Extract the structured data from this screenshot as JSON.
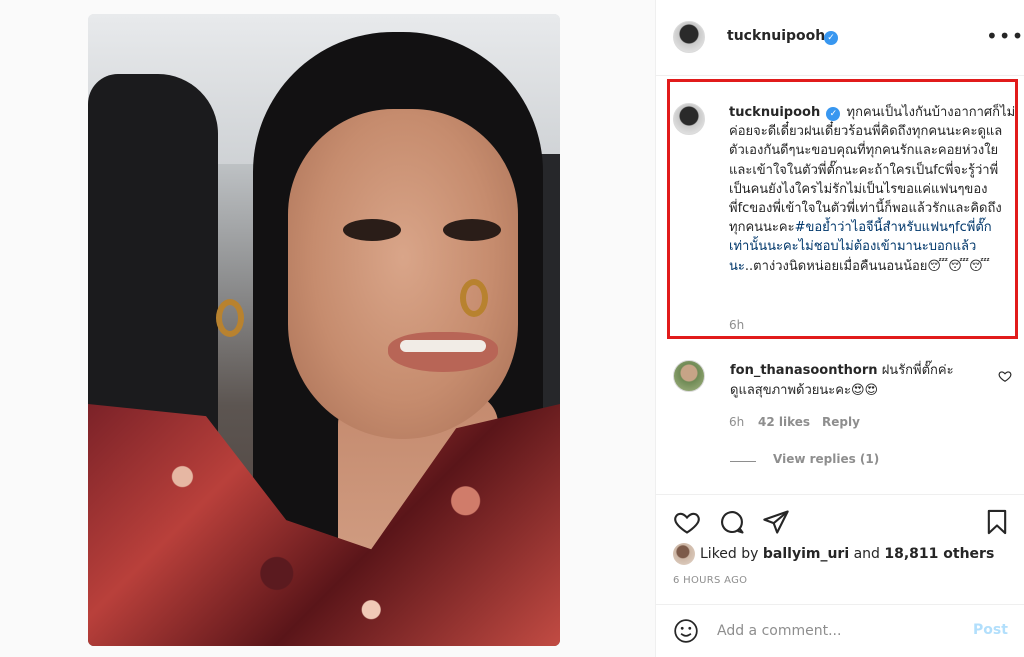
{
  "photo": {
    "alt": ""
  },
  "header": {
    "username": "tucknuipooh",
    "verified_glyph": "✓",
    "more_glyph": "•••"
  },
  "caption": {
    "username": "tucknuipooh",
    "verified_glyph": "✓",
    "text_main": "ทุกคนเป็นไงกันบ้างอากาศก็ไม่ค่อยจะดีเดี๋ยวฝนเดี๋ยวร้อนพี่คิดถึงทุกคนนะคะดูแลตัวเองกันดีๆนะขอบคุณที่ทุกคนรักและคอยห่วงใยและเข้าใจในตัวพี่ตั๊กนะคะถ้าใครเป็นfcพี่จะรู้ว่าพี่เป็นคนยังไงใครไม่รักไม่เป็นไรขอแค่แฟนๆของพี่fcของพี่เข้าใจในตัวพี่เท่านี้ก็พอแล้วรักและคิดถึงทุกคนนะคะ",
    "hashtag": "#ขอย้ำว่าไอจีนี้สำหรับแฟนๆfcพี่ตั๊กเท่านั้นนะคะไม่ชอบไม่ต้องเข้ามานะบอกแล้วนะ",
    "text_end": "..ตาง่วงนิดหน่อยเมื่อคืนนอนน้อย😴😴😴",
    "time": "6h"
  },
  "comment": {
    "username": "fon_thanasoonthorn",
    "text": "ฝนรักพี่ตั๊กค่ะ ดูแลสุขภาพด้วยนะคะ😍😍",
    "time": "6h",
    "likes": "42 likes",
    "reply": "Reply",
    "view_replies": "View replies (1)"
  },
  "actions": {
    "icons": [
      "heart-icon",
      "comment-icon",
      "share-icon",
      "bookmark-icon"
    ]
  },
  "likes": {
    "prefix": "Liked by ",
    "user": "ballyim_uri",
    "middle": " and ",
    "others": "18,811 others"
  },
  "timestamp": "6 HOURS AGO",
  "add_comment": {
    "placeholder": "Add a comment...",
    "post_label": "Post"
  },
  "colors": {
    "highlight_border": "#e11b1b",
    "verified": "#3897f0",
    "post_disabled": "#b2dffc",
    "hashtag": "#00376b"
  }
}
